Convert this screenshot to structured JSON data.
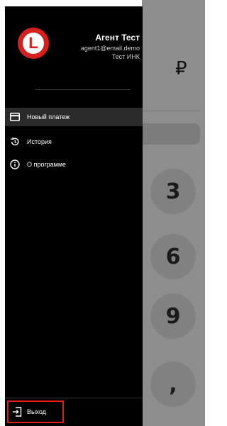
{
  "background_app": {
    "currency_symbol": "₽",
    "keys": [
      "3",
      "6",
      "9",
      ","
    ]
  },
  "drawer": {
    "logo_letter": "L",
    "user": {
      "name": "Агент Тест",
      "email": "agent1@email.demo",
      "company": "Тест ИНК"
    },
    "menu": [
      {
        "label": "Новый платеж",
        "icon": "credit-card-icon",
        "active": true
      },
      {
        "label": "История",
        "icon": "history-icon",
        "active": false
      },
      {
        "label": "О программе",
        "icon": "info-icon",
        "active": false
      }
    ],
    "logout": {
      "label": "Выход",
      "icon": "logout-icon"
    }
  },
  "colors": {
    "drawer_bg": "#000000",
    "active_item_bg": "#2a2a2a",
    "highlight_border": "#e01919",
    "logo_red": "#d62020",
    "overlay_gray": "#8e8e8e"
  }
}
